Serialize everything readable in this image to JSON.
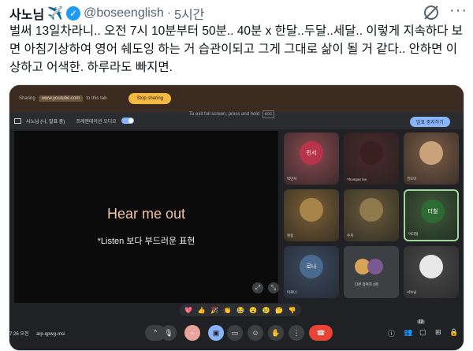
{
  "post": {
    "display_name": "사노님",
    "plane_emoji": "✈️",
    "verified_icon": "verified-badge-icon",
    "handle": "@boseenglish",
    "separator": "·",
    "time": "5시간",
    "text": "벌써 13일차라니.. 오전 7시 10분부터 50분.. 40분 x 한달..두달..세달.. 이렇게 지속하다 보면 아침기상하여 영어 쉐도잉 하는 거 습관이되고 그게 그대로 삶이 될 거 같다.. 안하면 이상하고 어색한. 하루라도 빠지면.",
    "more_label": "···"
  },
  "screenshot": {
    "share_bar": {
      "sharing": "Sharing",
      "url": "www.youtube.com",
      "to_tab": "to this tab",
      "stop_sharing": "Stop sharing"
    },
    "meet_bar": {
      "self_label": "사노님 (나, 발표 중)",
      "presentation_audio": "프레젠테이션 오디오",
      "exit_hint": "To exit full screen, press and hold",
      "esc_key": "esc",
      "stop_presenting": "발표 중지하기"
    },
    "stage": {
      "headline": "Hear me out",
      "subtitle": "*Listen 보다 부드러운 표현",
      "rotate_icon": "⤢",
      "fullscreen_icon": "⤡"
    },
    "tiles": [
      {
        "name": "박민서",
        "initial": "민서"
      },
      {
        "name": "Thumper lee",
        "initial": ""
      },
      {
        "name": "권오아",
        "initial": ""
      },
      {
        "name": "원용",
        "initial": ""
      },
      {
        "name": "수지",
        "initial": ""
      },
      {
        "name": "이더철",
        "initial": "더철"
      },
      {
        "name": "마로나",
        "initial": "로나"
      },
      {
        "name": "다른 참여자 3명",
        "initial": ""
      },
      {
        "name": "서누님",
        "initial": ""
      }
    ],
    "reactions": [
      "💖",
      "👍",
      "🎉",
      "👏",
      "😂",
      "😮",
      "😢",
      "🤔",
      "👎"
    ],
    "bottom_bar": {
      "time": "7:26 오전",
      "meeting_code": "arp-qpwg-msi",
      "participant_count": "13"
    }
  },
  "colors": {
    "verified": "#1d9bf0",
    "stop_sharing_button": "#f5b942",
    "leave_button": "#ea4335",
    "headline": "#f2c4a4"
  }
}
